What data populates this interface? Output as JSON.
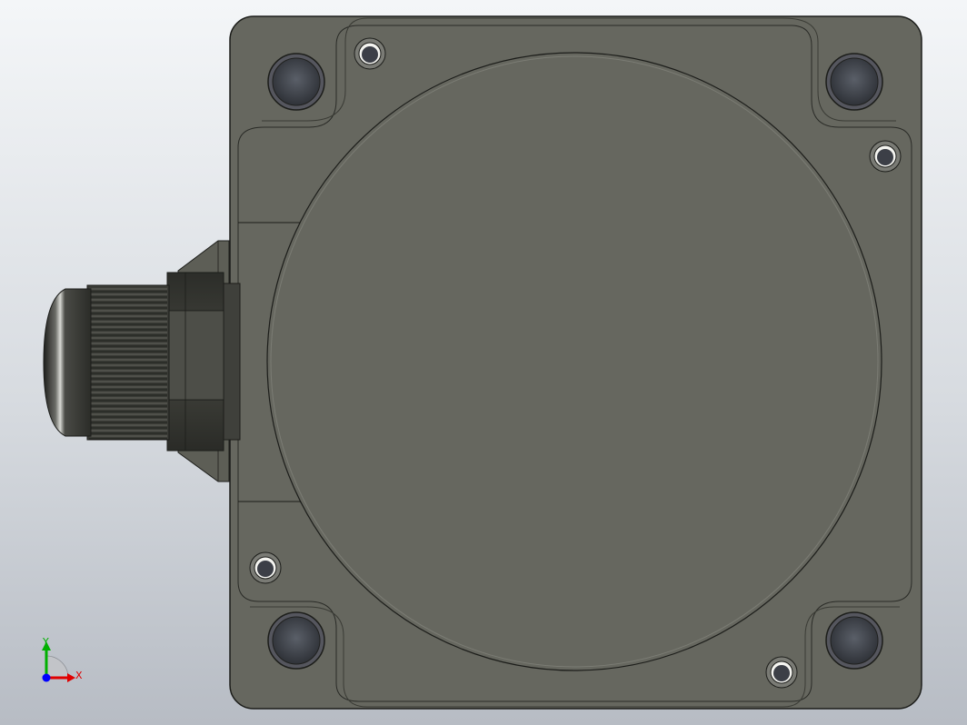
{
  "viewport": {
    "background_top": "#f4f6f8",
    "background_bottom": "#b7bcc4"
  },
  "part": {
    "body_color": "#66675f",
    "edge_color": "#1c1d1a",
    "cable_gland_color": "#3a3b36",
    "hole_color": "#4e5158"
  },
  "triad": {
    "x_label": "X",
    "y_label": "Y",
    "x_color": "#e00000",
    "y_color": "#00b000",
    "z_color": "#0000ff"
  }
}
